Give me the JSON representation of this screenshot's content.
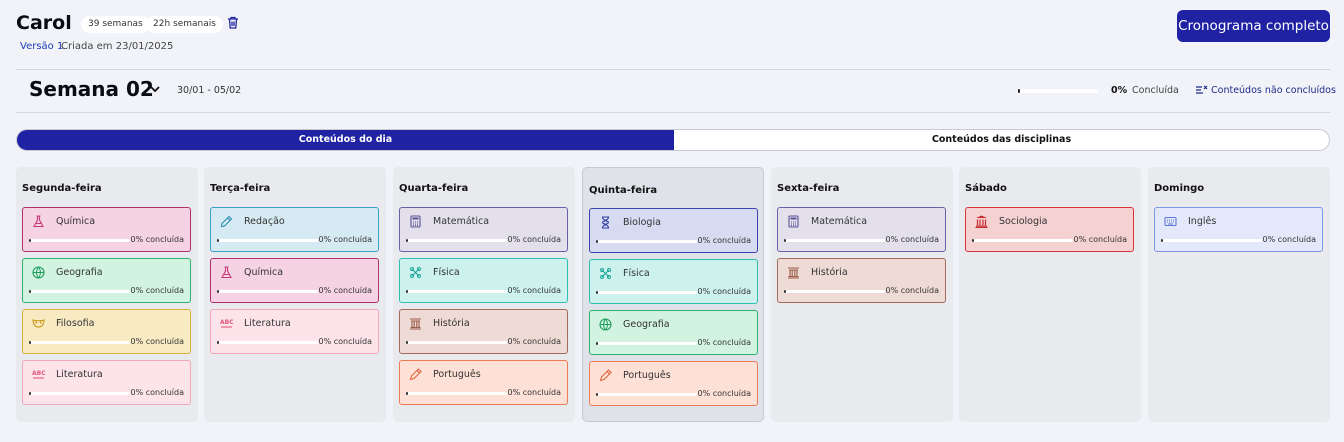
{
  "header": {
    "name": "Carol",
    "weeks_badge": "39 semanas",
    "hours_badge": "22h semanais",
    "version": "Versão 1",
    "created": "Criada em 23/01/2025",
    "schedule_button": "Cronograma completo"
  },
  "week": {
    "title": "Semana 02",
    "range": "30/01 - 05/02",
    "progress_pct": "0%",
    "progress_fraction": 0,
    "progress_label": "Concluída",
    "filter_link": "Conteúdos não concluídos"
  },
  "tabs": {
    "day": "Conteúdos do dia",
    "subjects": "Conteúdos das disciplinas",
    "active": "day"
  },
  "colors": {
    "accent": "#1f23a3"
  },
  "days": [
    {
      "name": "Segunda-feira",
      "active": false,
      "cards": [
        {
          "subject": "Química",
          "icon": "flask-icon",
          "theme": "pink",
          "pct": "0% concluída"
        },
        {
          "subject": "Geografia",
          "icon": "globe-icon",
          "theme": "green",
          "pct": "0% concluída"
        },
        {
          "subject": "Filosofia",
          "icon": "mask-icon",
          "theme": "yellow",
          "pct": "0% concluída"
        },
        {
          "subject": "Literatura",
          "icon": "abc-icon",
          "theme": "lightpink",
          "pct": "0% concluída"
        }
      ]
    },
    {
      "name": "Terça-feira",
      "active": false,
      "cards": [
        {
          "subject": "Redação",
          "icon": "pencil-icon",
          "theme": "blue",
          "pct": "0% concluída"
        },
        {
          "subject": "Química",
          "icon": "flask-icon",
          "theme": "pink",
          "pct": "0% concluída"
        },
        {
          "subject": "Literatura",
          "icon": "abc-icon",
          "theme": "lightpink",
          "pct": "0% concluída"
        }
      ]
    },
    {
      "name": "Quarta-feira",
      "active": false,
      "cards": [
        {
          "subject": "Matemática",
          "icon": "calculator-icon",
          "theme": "purple",
          "pct": "0% concluída"
        },
        {
          "subject": "Física",
          "icon": "atom-icon",
          "theme": "teal",
          "pct": "0% concluída"
        },
        {
          "subject": "História",
          "icon": "column-icon",
          "theme": "brown",
          "pct": "0% concluída"
        },
        {
          "subject": "Português",
          "icon": "pen-icon",
          "theme": "orange",
          "pct": "0% concluída"
        }
      ]
    },
    {
      "name": "Quinta-feira",
      "active": true,
      "cards": [
        {
          "subject": "Biologia",
          "icon": "dna-icon",
          "theme": "indigo",
          "pct": "0% concluída"
        },
        {
          "subject": "Física",
          "icon": "atom-icon",
          "theme": "teal",
          "pct": "0% concluída"
        },
        {
          "subject": "Geografia",
          "icon": "globe-icon",
          "theme": "green",
          "pct": "0% concluída"
        },
        {
          "subject": "Português",
          "icon": "pen-icon",
          "theme": "orange",
          "pct": "0% concluída"
        }
      ]
    },
    {
      "name": "Sexta-feira",
      "active": false,
      "cards": [
        {
          "subject": "Matemática",
          "icon": "calculator-icon",
          "theme": "purple",
          "pct": "0% concluída"
        },
        {
          "subject": "História",
          "icon": "column-icon",
          "theme": "brown",
          "pct": "0% concluída"
        }
      ]
    },
    {
      "name": "Sábado",
      "active": false,
      "cards": [
        {
          "subject": "Sociologia",
          "icon": "institution-icon",
          "theme": "red",
          "pct": "0% concluída"
        }
      ]
    },
    {
      "name": "Domingo",
      "active": false,
      "cards": [
        {
          "subject": "Inglês",
          "icon": "keyboard-icon",
          "theme": "lavender",
          "pct": "0% concluída"
        }
      ]
    }
  ],
  "themes": {
    "pink": {
      "bg": "#f6d3e2",
      "border": "#b0306a",
      "icon": "#c83b7a"
    },
    "green": {
      "bg": "#d3f3e1",
      "border": "#2fb070",
      "icon": "#1f9e5e"
    },
    "yellow": {
      "bg": "#f8ebc4",
      "border": "#d9b13a",
      "icon": "#c89a18"
    },
    "lightpink": {
      "bg": "#fde4ea",
      "border": "#f0a7b8",
      "icon": "#e0597c"
    },
    "blue": {
      "bg": "#d6eaf3",
      "border": "#3aa0c6",
      "icon": "#2d8db4"
    },
    "purple": {
      "bg": "#e3e0ec",
      "border": "#6a5fa8",
      "icon": "#5b5096"
    },
    "teal": {
      "bg": "#cdf2ee",
      "border": "#2fbfb0",
      "icon": "#1aa99a"
    },
    "brown": {
      "bg": "#efdbd6",
      "border": "#a56a5a",
      "icon": "#9a5a48"
    },
    "orange": {
      "bg": "#fde0d6",
      "border": "#ef7a56",
      "icon": "#e2653e"
    },
    "indigo": {
      "bg": "#d6dbf1",
      "border": "#3a44b0",
      "icon": "#2f3aa4"
    },
    "red": {
      "bg": "#f5d2d2",
      "border": "#d6333a",
      "icon": "#c42a2f"
    },
    "lavender": {
      "bg": "#e3e8fb",
      "border": "#8096e6",
      "icon": "#5f77d6"
    }
  }
}
